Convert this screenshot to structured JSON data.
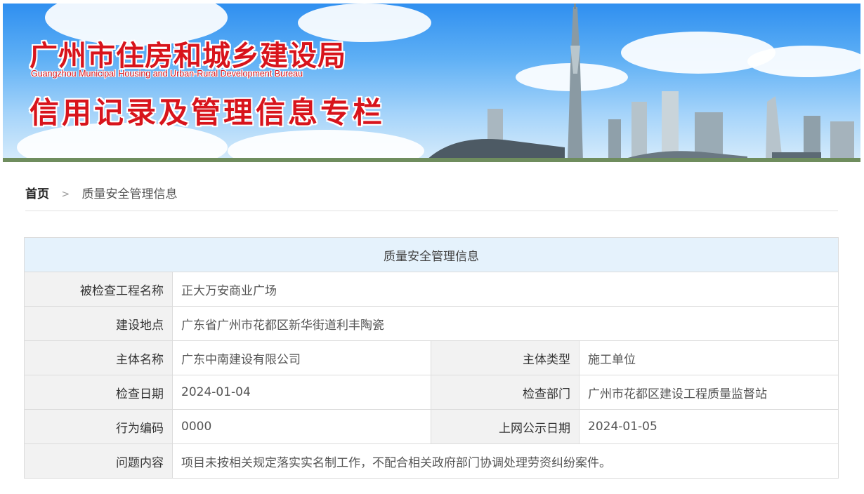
{
  "banner": {
    "title": "广州市住房和城乡建设局",
    "subtitle": "Guangzhou Municipal Housing and Urban-Rural Development Bureau",
    "slogan": "信用记录及管理信息专栏"
  },
  "breadcrumb": {
    "home": "首页",
    "separator": ">",
    "current": "质量安全管理信息"
  },
  "table": {
    "caption": "质量安全管理信息",
    "project_name_label": "被检查工程名称",
    "project_name": "正大万安商业广场",
    "location_label": "建设地点",
    "location": "广东省广州市花都区新华街道利丰陶瓷",
    "entity_name_label": "主体名称",
    "entity_name": "广东中南建设有限公司",
    "entity_type_label": "主体类型",
    "entity_type": "施工单位",
    "inspect_date_label": "检查日期",
    "inspect_date": "2024-01-04",
    "inspect_dept_label": "检查部门",
    "inspect_dept": "广州市花都区建设工程质量监督站",
    "behavior_code_label": "行为编码",
    "behavior_code": "0000",
    "publish_date_label": "上网公示日期",
    "publish_date": "2024-01-05",
    "issue_label": "问题内容",
    "issue": "项目未按相关规定落实实名制工作，不配合相关政府部门协调处理劳资纠纷案件。"
  },
  "colors": {
    "banner_text": "#d8141c",
    "caption_bg": "#e5f2fc",
    "label_bg": "#f2f2f2"
  }
}
